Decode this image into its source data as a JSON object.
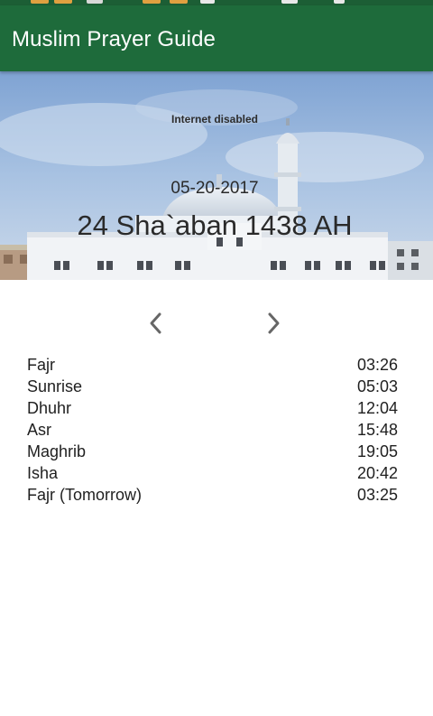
{
  "app": {
    "title": "Muslim Prayer Guide"
  },
  "header": {
    "internet_status": "Internet disabled",
    "gregorian_date": "05-20-2017",
    "hijri_date": "24 Sha`aban 1438 AH"
  },
  "navigation": {
    "previous_icon": "chevron-left-icon",
    "next_icon": "chevron-right-icon"
  },
  "prayers": [
    {
      "name": "Fajr",
      "time": "03:26"
    },
    {
      "name": "Sunrise",
      "time": "05:03"
    },
    {
      "name": "Dhuhr",
      "time": "12:04"
    },
    {
      "name": "Asr",
      "time": "15:48"
    },
    {
      "name": "Maghrib",
      "time": "19:05"
    },
    {
      "name": "Isha",
      "time": "20:42"
    },
    {
      "name": "Fajr (Tomorrow)",
      "time": "03:25"
    }
  ],
  "colors": {
    "app_bar": "#1e6b3b",
    "text": "#1f1f1f",
    "chevron": "#666666"
  }
}
